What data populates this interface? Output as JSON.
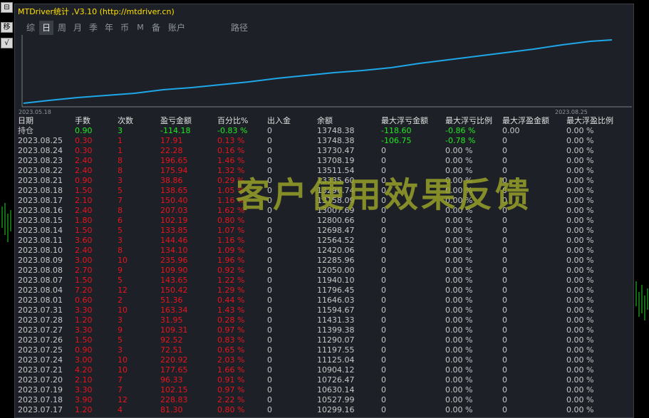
{
  "window": {
    "title": "MTDriver统计 ,V3.10 (http://mtdriver.cn)"
  },
  "side_buttons": [
    "⊟",
    "移",
    "√"
  ],
  "tabs": [
    {
      "label": "综",
      "active": false
    },
    {
      "label": "日",
      "active": true
    },
    {
      "label": "周",
      "active": false
    },
    {
      "label": "月",
      "active": false
    },
    {
      "label": "季",
      "active": false
    },
    {
      "label": "年",
      "active": false
    },
    {
      "label": "币",
      "active": false
    },
    {
      "label": "M",
      "active": false
    },
    {
      "label": "备",
      "active": false
    },
    {
      "label": "账户",
      "active": false
    },
    {
      "label": "路径",
      "active": false
    }
  ],
  "chart": {
    "start_label": "2023.05.18",
    "end_label": "2023.08.25",
    "line_color": "#1ea7e8"
  },
  "table": {
    "headers": [
      "日期",
      "手数",
      "次数",
      "盈亏金额",
      "百分比%",
      "出入金",
      "余额",
      "最大浮亏金额",
      "最大浮亏比例",
      "最大浮盈金额",
      "最大浮盈比例"
    ],
    "holding": [
      "持仓",
      "0.90",
      "3",
      "-114.18",
      "-0.83 %",
      "0",
      "13748.38",
      "-118.60",
      "-0.86 %",
      "0.00",
      "0.00 %"
    ],
    "rows": [
      [
        "2023.08.25",
        "0.30",
        "1",
        "17.91",
        "0.13 %",
        "0",
        "13748.38",
        "-106.75",
        "-0.78 %",
        "0",
        "0.00 %"
      ],
      [
        "2023.08.24",
        "0.30",
        "1",
        "22.28",
        "0.16 %",
        "0",
        "13730.47",
        "0",
        "0.00 %",
        "0",
        "0.00 %"
      ],
      [
        "2023.08.23",
        "2.40",
        "8",
        "196.65",
        "1.46 %",
        "0",
        "13708.19",
        "0",
        "0.00 %",
        "0",
        "0.00 %"
      ],
      [
        "2023.08.22",
        "2.40",
        "8",
        "175.94",
        "1.32 %",
        "0",
        "13511.54",
        "0",
        "0.00 %",
        "0",
        "0.00 %"
      ],
      [
        "2023.08.21",
        "0.90",
        "3",
        "38.86",
        "0.29 %",
        "0",
        "13335.60",
        "0",
        "0.00 %",
        "0",
        "0.00 %"
      ],
      [
        "2023.08.18",
        "1.50",
        "5",
        "138.65",
        "1.05 %",
        "0",
        "13296.74",
        "0",
        "0.00 %",
        "0",
        "0.00 %"
      ],
      [
        "2023.08.17",
        "2.10",
        "7",
        "150.40",
        "1.16 %",
        "0",
        "13158.09",
        "0",
        "0.00 %",
        "0",
        "0.00 %"
      ],
      [
        "2023.08.16",
        "2.40",
        "8",
        "207.03",
        "1.62 %",
        "0",
        "13007.69",
        "0",
        "0.00 %",
        "0",
        "0.00 %"
      ],
      [
        "2023.08.15",
        "1.80",
        "6",
        "102.19",
        "0.80 %",
        "0",
        "12800.66",
        "0",
        "0.00 %",
        "0",
        "0.00 %"
      ],
      [
        "2023.08.14",
        "1.50",
        "5",
        "133.85",
        "1.07 %",
        "0",
        "12698.47",
        "0",
        "0.00 %",
        "0",
        "0.00 %"
      ],
      [
        "2023.08.11",
        "3.60",
        "3",
        "144.46",
        "1.16 %",
        "0",
        "12564.52",
        "0",
        "0.00 %",
        "0",
        "0.00 %"
      ],
      [
        "2023.08.10",
        "2.40",
        "8",
        "134.10",
        "1.09 %",
        "0",
        "12420.06",
        "0",
        "0.00 %",
        "0",
        "0.00 %"
      ],
      [
        "2023.08.09",
        "3.00",
        "10",
        "235.96",
        "1.96 %",
        "0",
        "12285.96",
        "0",
        "0.00 %",
        "0",
        "0.00 %"
      ],
      [
        "2023.08.08",
        "2.70",
        "9",
        "109.90",
        "0.92 %",
        "0",
        "12050.00",
        "0",
        "0.00 %",
        "0",
        "0.00 %"
      ],
      [
        "2023.08.07",
        "1.50",
        "5",
        "143.65",
        "1.22 %",
        "0",
        "11940.10",
        "0",
        "0.00 %",
        "0",
        "0.00 %"
      ],
      [
        "2023.08.04",
        "7.20",
        "12",
        "150.42",
        "1.29 %",
        "0",
        "11796.45",
        "0",
        "0.00 %",
        "0",
        "0.00 %"
      ],
      [
        "2023.08.01",
        "0.60",
        "2",
        "51.36",
        "0.44 %",
        "0",
        "11646.03",
        "0",
        "0.00 %",
        "0",
        "0.00 %"
      ],
      [
        "2023.07.31",
        "3.30",
        "10",
        "163.34",
        "1.43 %",
        "0",
        "11594.67",
        "0",
        "0.00 %",
        "0",
        "0.00 %"
      ],
      [
        "2023.07.28",
        "1.20",
        "3",
        "31.95",
        "0.28 %",
        "0",
        "11431.33",
        "0",
        "0.00 %",
        "0",
        "0.00 %"
      ],
      [
        "2023.07.27",
        "3.30",
        "9",
        "109.31",
        "0.97 %",
        "0",
        "11399.38",
        "0",
        "0.00 %",
        "0",
        "0.00 %"
      ],
      [
        "2023.07.26",
        "1.50",
        "5",
        "92.52",
        "0.83 %",
        "0",
        "11290.07",
        "0",
        "0.00 %",
        "0",
        "0.00 %"
      ],
      [
        "2023.07.25",
        "0.90",
        "3",
        "72.51",
        "0.65 %",
        "0",
        "11197.55",
        "0",
        "0.00 %",
        "0",
        "0.00 %"
      ],
      [
        "2023.07.24",
        "3.00",
        "10",
        "220.92",
        "2.03 %",
        "0",
        "11125.04",
        "0",
        "0.00 %",
        "0",
        "0.00 %"
      ],
      [
        "2023.07.21",
        "4.20",
        "10",
        "177.65",
        "1.66 %",
        "0",
        "10904.12",
        "0",
        "0.00 %",
        "0",
        "0.00 %"
      ],
      [
        "2023.07.20",
        "2.10",
        "7",
        "96.33",
        "0.91 %",
        "0",
        "10726.47",
        "0",
        "0.00 %",
        "0",
        "0.00 %"
      ],
      [
        "2023.07.19",
        "3.30",
        "7",
        "102.15",
        "0.97 %",
        "0",
        "10630.14",
        "0",
        "0.00 %",
        "0",
        "0.00 %"
      ],
      [
        "2023.07.18",
        "3.90",
        "12",
        "228.83",
        "2.22 %",
        "0",
        "10527.99",
        "0",
        "0.00 %",
        "0",
        "0.00 %"
      ],
      [
        "2023.07.17",
        "1.20",
        "4",
        "81.30",
        "0.80 %",
        "0",
        "10299.16",
        "0",
        "0.00 %",
        "0",
        "0.00 %"
      ]
    ]
  },
  "overlay_text": "客户使用效果反馈"
}
